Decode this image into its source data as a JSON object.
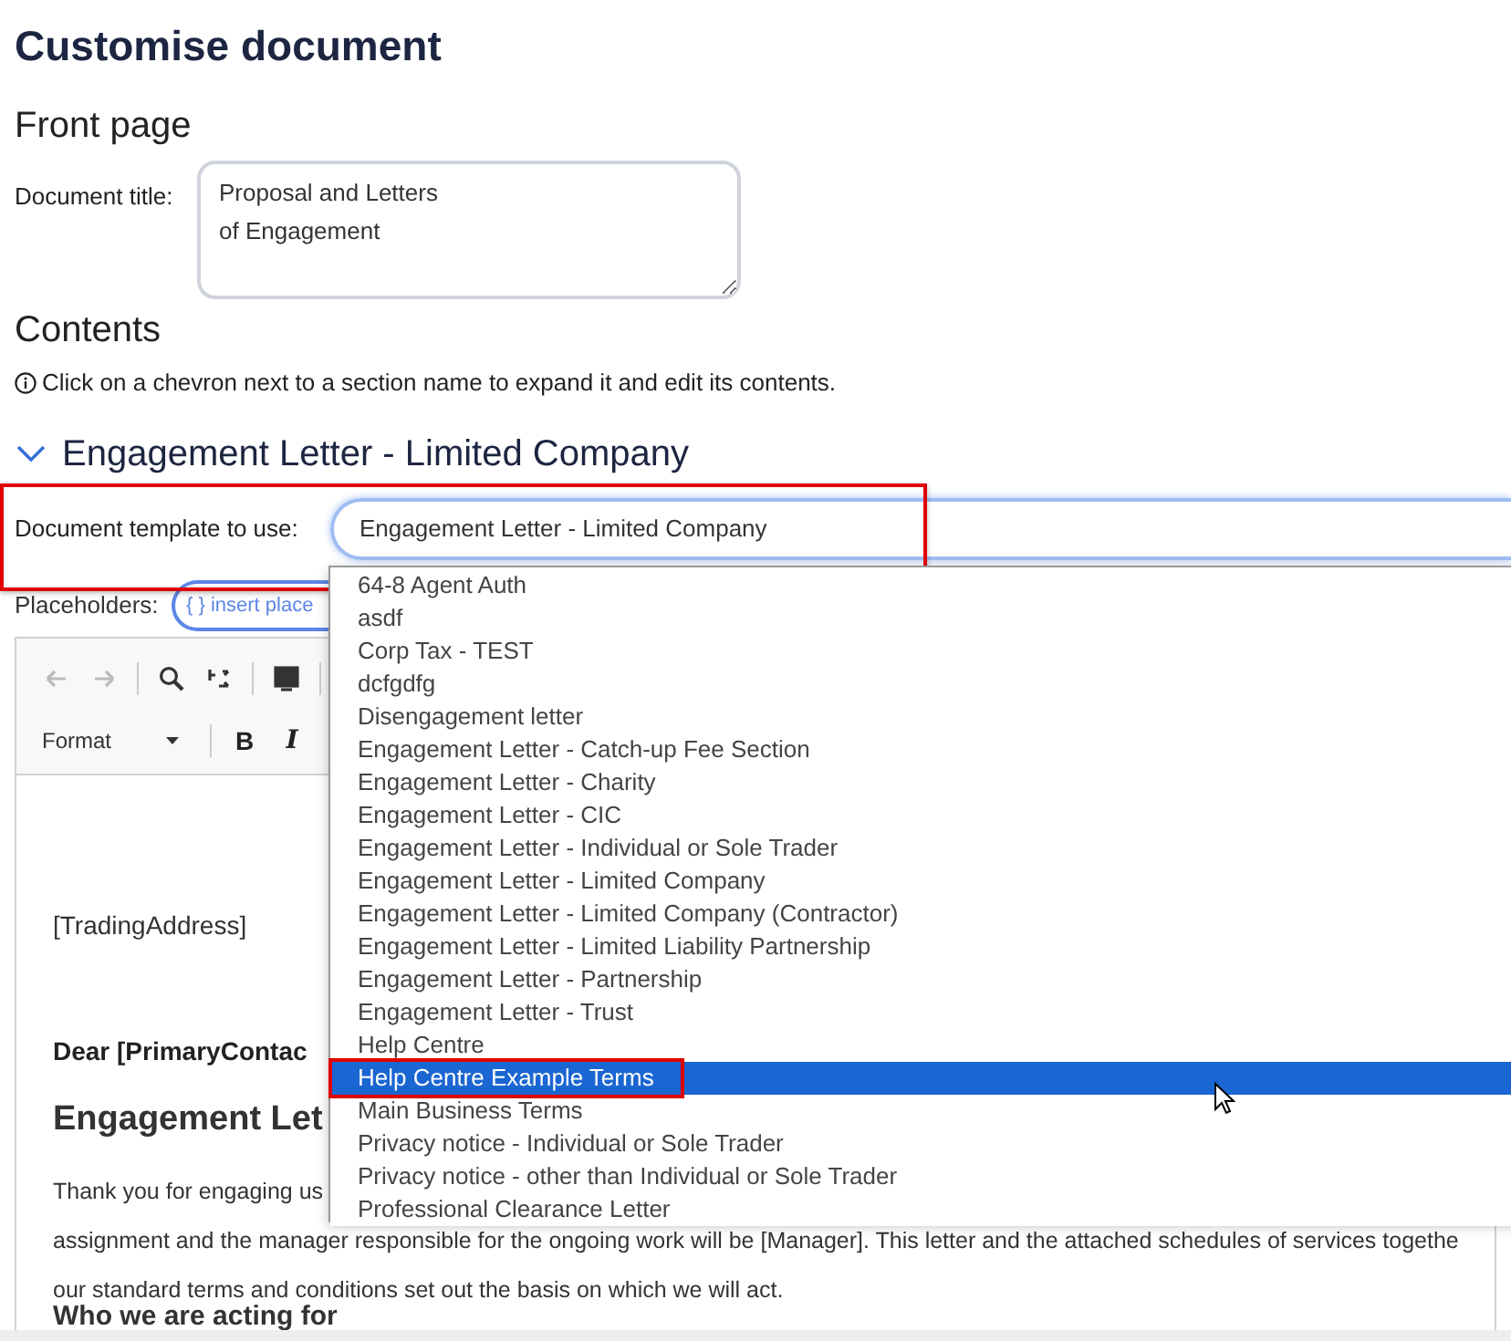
{
  "page_title": "Customise document",
  "front_page": {
    "heading": "Front page",
    "title_label": "Document title:",
    "title_value": "Proposal and Letters\nof Engagement"
  },
  "contents": {
    "heading": "Contents",
    "hint": "Click on a chevron next to a section name to expand it and edit its contents."
  },
  "section": {
    "title": "Engagement Letter - Limited Company",
    "expanded": true,
    "template_label": "Document template to use:",
    "template_value": "Engagement Letter - Limited Company",
    "placeholders_label": "Placeholders:",
    "placeholder_button": "{ } insert place",
    "format_label": "Format",
    "bold": "B",
    "italic": "I",
    "editor_lines": [
      {
        "kind": "address",
        "text": "[TradingAddress]"
      },
      {
        "kind": "greeting",
        "text": "Dear [PrimaryContac"
      },
      {
        "kind": "heading",
        "text": "Engagement Let"
      },
      {
        "kind": "para",
        "text": "Thank you for engaging us"
      },
      {
        "kind": "para",
        "text": "assignment and the manager responsible for the ongoing work will be [Manager]. This letter and the attached schedules of services togethe"
      },
      {
        "kind": "para",
        "text": "our standard terms and conditions set out the basis on which we will act."
      },
      {
        "kind": "subheading",
        "text": "Who we are acting for"
      }
    ]
  },
  "template_options": [
    {
      "label": "64-8 Agent Auth",
      "selected": false
    },
    {
      "label": "asdf",
      "selected": false
    },
    {
      "label": "Corp Tax - TEST",
      "selected": false
    },
    {
      "label": "dcfgdfg",
      "selected": false
    },
    {
      "label": "Disengagement letter",
      "selected": false
    },
    {
      "label": "Engagement Letter - Catch-up Fee Section",
      "selected": false
    },
    {
      "label": "Engagement Letter - Charity",
      "selected": false
    },
    {
      "label": "Engagement Letter - CIC",
      "selected": false
    },
    {
      "label": "Engagement Letter - Individual or Sole Trader",
      "selected": false
    },
    {
      "label": "Engagement Letter - Limited Company",
      "selected": false
    },
    {
      "label": "Engagement Letter - Limited Company (Contractor)",
      "selected": false
    },
    {
      "label": "Engagement Letter - Limited Liability Partnership",
      "selected": false
    },
    {
      "label": "Engagement Letter - Partnership",
      "selected": false
    },
    {
      "label": "Engagement Letter - Trust",
      "selected": false
    },
    {
      "label": "Help Centre",
      "selected": false
    },
    {
      "label": "Help Centre Example Terms",
      "selected": true
    },
    {
      "label": "Main Business Terms",
      "selected": false
    },
    {
      "label": "Privacy notice - Individual or Sole Trader",
      "selected": false
    },
    {
      "label": "Privacy notice - other than Individual or Sole Trader",
      "selected": false
    },
    {
      "label": "Professional Clearance Letter",
      "selected": false
    }
  ]
}
